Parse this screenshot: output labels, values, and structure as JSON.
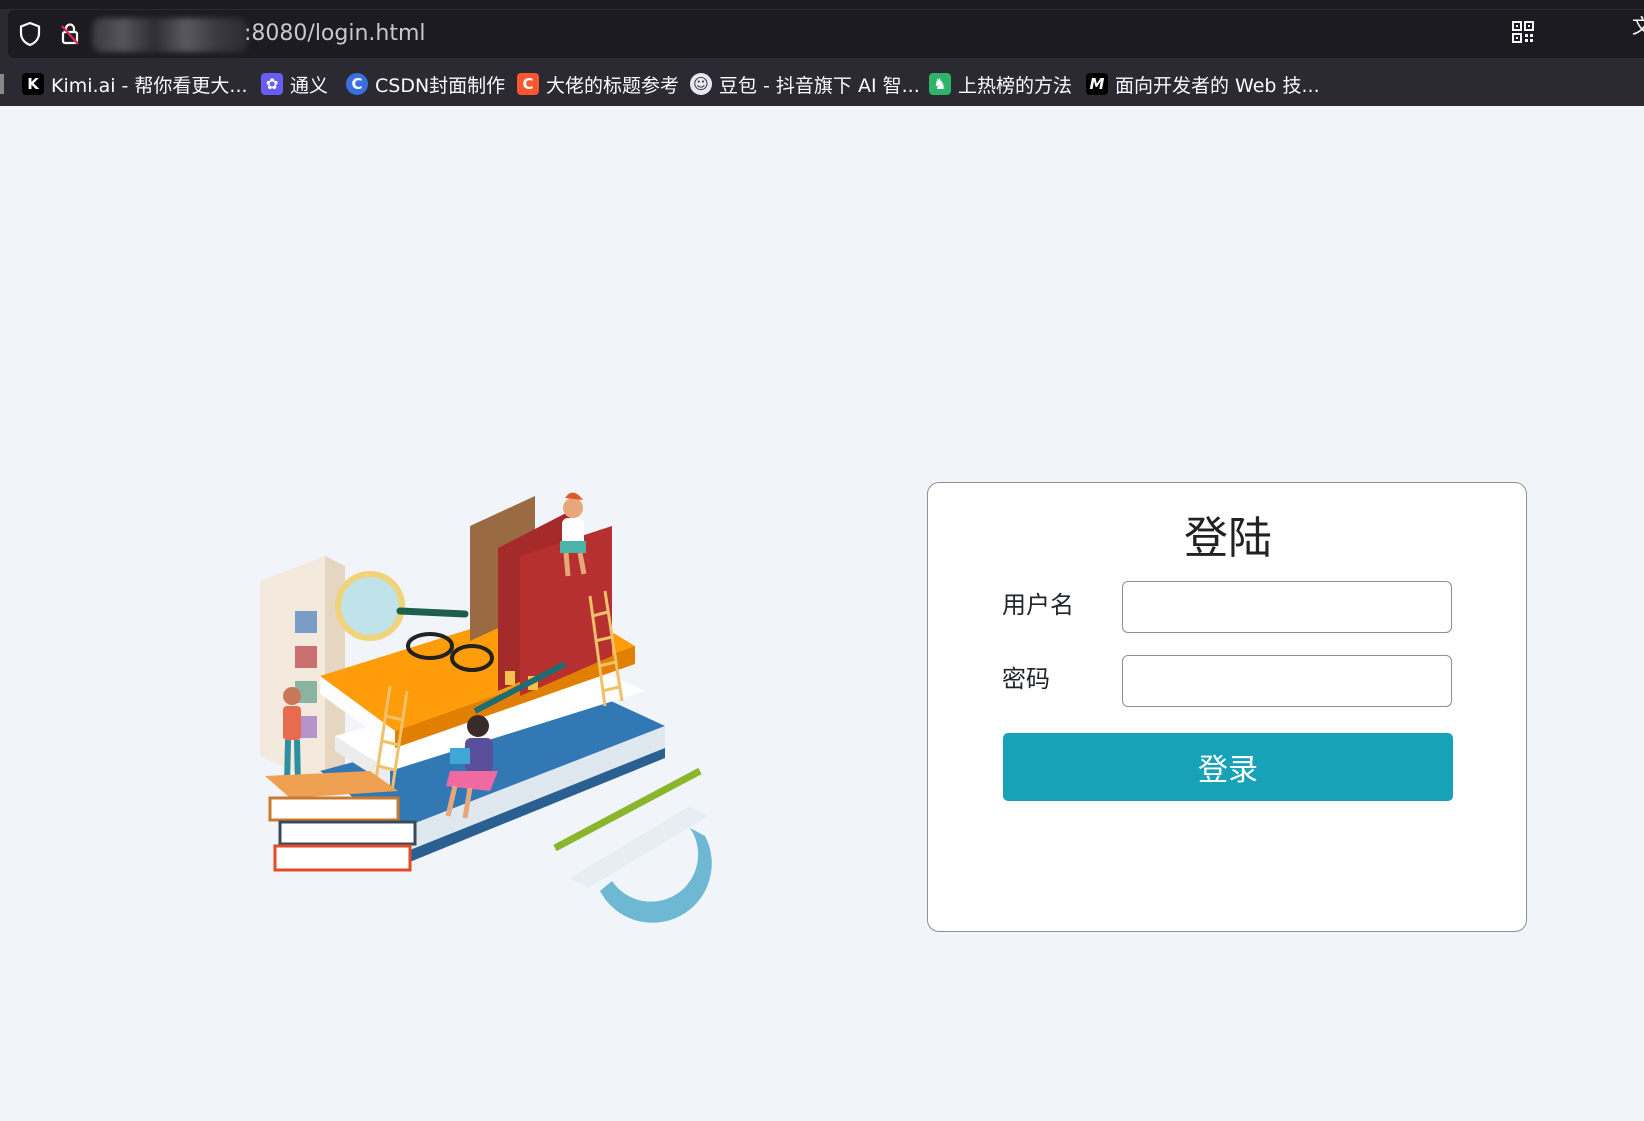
{
  "browser": {
    "url_suffix": ":8080/login.html",
    "edge_glyph": "文",
    "bookmarks": [
      {
        "label": "Kimi.ai - 帮你看更大...",
        "icon": "kimi-icon",
        "icon_char": "K",
        "color": "#000000"
      },
      {
        "label": "通义",
        "icon": "tongyi-icon",
        "icon_char": "✿",
        "color": "#6b5cf6"
      },
      {
        "label": "CSDN封面制作",
        "icon": "canva-icon",
        "icon_char": "C",
        "color": "#3b6fe0"
      },
      {
        "label": "大佬的标题参考",
        "icon": "csdn-icon",
        "icon_char": "C",
        "color": "#fc5531"
      },
      {
        "label": "豆包 - 抖音旗下 AI 智...",
        "icon": "doubao-icon",
        "icon_char": "☺",
        "color": "#e9e6f5"
      },
      {
        "label": "上热榜的方法",
        "icon": "hotlist-icon",
        "icon_char": "♞",
        "color": "#2fb36a"
      },
      {
        "label": "面向开发者的 Web 技...",
        "icon": "mdn-icon",
        "icon_char": "M",
        "color": "#000000"
      }
    ]
  },
  "login": {
    "title": "登陆",
    "username_label": "用户名",
    "username_value": "",
    "password_label": "密码",
    "password_value": "",
    "submit_label": "登录",
    "accent_color": "#17a2b8"
  }
}
